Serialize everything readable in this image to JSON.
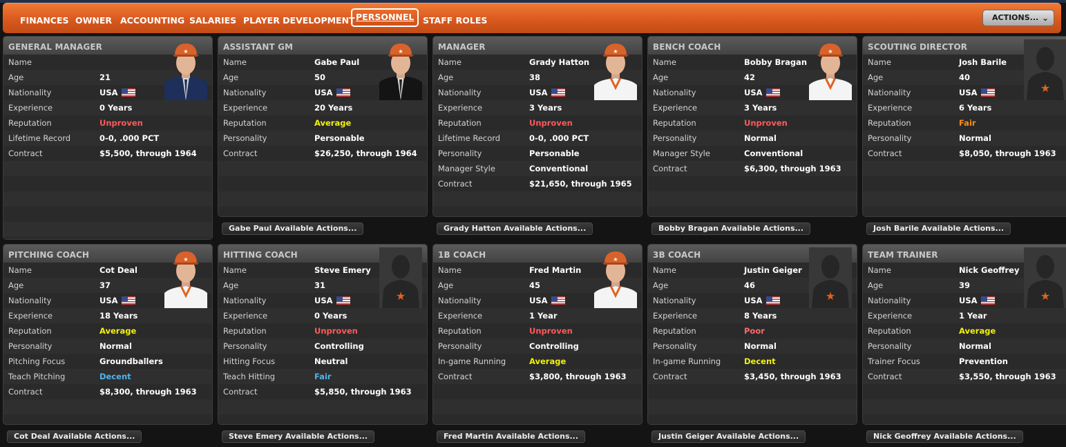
{
  "nav": {
    "items": [
      "FINANCES",
      "OWNER",
      "ACCOUNTING",
      "SALARIES",
      "PLAYER DEVELOPMENT",
      "PERSONNEL",
      "STAFF ROLES"
    ],
    "active": "PERSONNEL",
    "actions_label": "ACTIONS...",
    "actions_icon": "chevron-down-icon"
  },
  "colors": {
    "nav_orange": "#e0631f",
    "unproven": "#ff5a5a",
    "average": "#f2f20a",
    "fair": "#ff8c1a",
    "decent": "#4fb4ef"
  },
  "cards": [
    {
      "title": "GENERAL MANAGER",
      "portrait": "suit",
      "action": "",
      "rows": [
        [
          "Name",
          ""
        ],
        [
          "Age",
          "21"
        ],
        [
          "Nationality",
          "USA"
        ],
        [
          "Experience",
          "0 Years"
        ],
        [
          "Reputation",
          "Unproven"
        ],
        [
          "Lifetime Record",
          "0-0, .000 PCT"
        ],
        [
          "Contract",
          "$5,500, through 1964"
        ]
      ]
    },
    {
      "title": "ASSISTANT GM",
      "portrait": "suit-dark",
      "action": "Gabe Paul Available Actions...",
      "rows": [
        [
          "Name",
          "Gabe Paul"
        ],
        [
          "Age",
          "50"
        ],
        [
          "Nationality",
          "USA"
        ],
        [
          "Experience",
          "20 Years"
        ],
        [
          "Reputation",
          "Average"
        ],
        [
          "Personality",
          "Personable"
        ],
        [
          "Contract",
          "$26,250, through 1964"
        ]
      ]
    },
    {
      "title": "MANAGER",
      "portrait": "uniform",
      "action": "Grady Hatton Available Actions...",
      "rows": [
        [
          "Name",
          "Grady Hatton"
        ],
        [
          "Age",
          "38"
        ],
        [
          "Nationality",
          "USA"
        ],
        [
          "Experience",
          "3 Years"
        ],
        [
          "Reputation",
          "Unproven"
        ],
        [
          "Lifetime Record",
          "0-0, .000 PCT"
        ],
        [
          "Personality",
          "Personable"
        ],
        [
          "Manager Style",
          "Conventional"
        ],
        [
          "Contract",
          "$21,650, through 1965"
        ]
      ]
    },
    {
      "title": "BENCH COACH",
      "portrait": "uniform",
      "action": "Bobby Bragan Available Actions...",
      "rows": [
        [
          "Name",
          "Bobby Bragan"
        ],
        [
          "Age",
          "42"
        ],
        [
          "Nationality",
          "USA"
        ],
        [
          "Experience",
          "3 Years"
        ],
        [
          "Reputation",
          "Unproven"
        ],
        [
          "Personality",
          "Normal"
        ],
        [
          "Manager Style",
          "Conventional"
        ],
        [
          "Contract",
          "$6,300, through 1963"
        ]
      ]
    },
    {
      "title": "SCOUTING DIRECTOR",
      "portrait": "silhouette",
      "action": "Josh Barile Available Actions...",
      "rows": [
        [
          "Name",
          "Josh Barile"
        ],
        [
          "Age",
          "40"
        ],
        [
          "Nationality",
          "USA"
        ],
        [
          "Experience",
          "6 Years"
        ],
        [
          "Reputation",
          "Fair"
        ],
        [
          "Personality",
          "Normal"
        ],
        [
          "Contract",
          "$8,050, through 1963"
        ]
      ]
    },
    {
      "title": "PITCHING COACH",
      "portrait": "uniform",
      "action": "Cot Deal Available Actions...",
      "rows": [
        [
          "Name",
          "Cot Deal"
        ],
        [
          "Age",
          "37"
        ],
        [
          "Nationality",
          "USA"
        ],
        [
          "Experience",
          "18 Years"
        ],
        [
          "Reputation",
          "Average"
        ],
        [
          "Personality",
          "Normal"
        ],
        [
          "Pitching Focus",
          "Groundballers"
        ],
        [
          "Teach Pitching",
          "Decent"
        ],
        [
          "Contract",
          "$8,300, through 1963"
        ]
      ]
    },
    {
      "title": "HITTING COACH",
      "portrait": "silhouette",
      "action": "Steve Emery Available Actions...",
      "rows": [
        [
          "Name",
          "Steve Emery"
        ],
        [
          "Age",
          "31"
        ],
        [
          "Nationality",
          "USA"
        ],
        [
          "Experience",
          "0 Years"
        ],
        [
          "Reputation",
          "Unproven"
        ],
        [
          "Personality",
          "Controlling"
        ],
        [
          "Hitting Focus",
          "Neutral"
        ],
        [
          "Teach Hitting",
          "Fair"
        ],
        [
          "Contract",
          "$5,850, through 1963"
        ]
      ]
    },
    {
      "title": "1B COACH",
      "portrait": "uniform",
      "action": "Fred Martin Available Actions...",
      "rows": [
        [
          "Name",
          "Fred Martin"
        ],
        [
          "Age",
          "45"
        ],
        [
          "Nationality",
          "USA"
        ],
        [
          "Experience",
          "1 Year"
        ],
        [
          "Reputation",
          "Unproven"
        ],
        [
          "Personality",
          "Controlling"
        ],
        [
          "In-game Running",
          "Average"
        ],
        [
          "Contract",
          "$3,800, through 1963"
        ]
      ]
    },
    {
      "title": "3B COACH",
      "portrait": "silhouette",
      "action": "Justin Geiger Available Actions...",
      "rows": [
        [
          "Name",
          "Justin Geiger"
        ],
        [
          "Age",
          "46"
        ],
        [
          "Nationality",
          "USA"
        ],
        [
          "Experience",
          "8 Years"
        ],
        [
          "Reputation",
          "Poor"
        ],
        [
          "Personality",
          "Normal"
        ],
        [
          "In-game Running",
          "Decent"
        ],
        [
          "Contract",
          "$3,450, through 1963"
        ]
      ]
    },
    {
      "title": "TEAM TRAINER",
      "portrait": "silhouette",
      "action": "Nick Geoffrey Available Actions...",
      "rows": [
        [
          "Name",
          "Nick Geoffrey"
        ],
        [
          "Age",
          "39"
        ],
        [
          "Nationality",
          "USA"
        ],
        [
          "Experience",
          "1 Year"
        ],
        [
          "Reputation",
          "Average"
        ],
        [
          "Personality",
          "Normal"
        ],
        [
          "Trainer Focus",
          "Prevention"
        ],
        [
          "Contract",
          "$3,550, through 1963"
        ]
      ]
    }
  ]
}
